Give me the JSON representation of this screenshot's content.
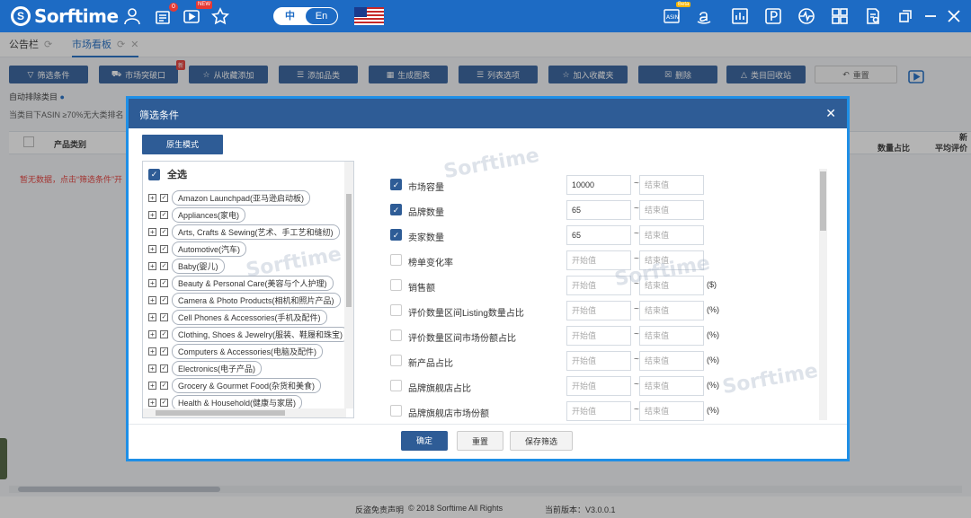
{
  "app": {
    "logo_text": "Sorftime",
    "logo_mark": "S",
    "notif_count": "0",
    "video_badge": "NEW",
    "lang_zh": "中",
    "lang_en": "En",
    "beta": "Beta"
  },
  "tabs": [
    {
      "label": "公告栏"
    },
    {
      "label": "市场看板"
    }
  ],
  "toolbar": {
    "filter": "筛选条件",
    "breakthrough": "市场突破口",
    "new_badge": "新",
    "add_from_fav": "从收藏添加",
    "add_category": "添加品类",
    "gen_chart": "生成图表",
    "columns": "列表选项",
    "add_fav": "加入收藏夹",
    "delete": "删除",
    "recycle": "类目回收站",
    "reset": "重置"
  },
  "background": {
    "auto_exclude": "自动排除类目",
    "rule": "当类目下ASIN ≥70%无大类排名",
    "col_category": "产品类别",
    "empty_msg": "暂无数据，点击“筛选条件”开",
    "right_cols": [
      "数量占比",
      "平均评价"
    ],
    "new_label": "新"
  },
  "modal": {
    "title": "筛选条件",
    "mode_button": "原生模式",
    "select_all": "全选",
    "categories": [
      "Amazon Launchpad(亚马逊启动板)",
      "Appliances(家电)",
      "Arts, Crafts & Sewing(艺术、手工艺和缝纫)",
      "Automotive(汽车)",
      "Baby(婴儿)",
      "Beauty & Personal Care(美容与个人护理)",
      "Camera & Photo Products(相机和照片产品)",
      "Cell Phones & Accessories(手机及配件)",
      "Clothing, Shoes & Jewelry(服装、鞋履和珠宝)",
      "Computers & Accessories(电脑及配件)",
      "Electronics(电子产品)",
      "Grocery & Gourmet Food(杂货和美食)",
      "Health & Household(健康与家居)"
    ],
    "filters": [
      {
        "label": "市场容量",
        "checked": true,
        "from": "10000",
        "to_placeholder": "结束值",
        "unit": ""
      },
      {
        "label": "品牌数量",
        "checked": true,
        "from": "65",
        "to_placeholder": "结束值",
        "unit": ""
      },
      {
        "label": "卖家数量",
        "checked": true,
        "from": "65",
        "to_placeholder": "结束值",
        "unit": ""
      },
      {
        "label": "榜单变化率",
        "checked": false,
        "from_placeholder": "开始值",
        "to_placeholder": "结束值",
        "unit": ""
      },
      {
        "label": "销售额",
        "checked": false,
        "from_placeholder": "开始值",
        "to_placeholder": "结束值",
        "unit": "($)"
      },
      {
        "label": "评价数量区间Listing数量占比",
        "checked": false,
        "from_placeholder": "开始值",
        "to_placeholder": "结束值",
        "unit": "(%)"
      },
      {
        "label": "评价数量区间市场份额占比",
        "checked": false,
        "from_placeholder": "开始值",
        "to_placeholder": "结束值",
        "unit": "(%)"
      },
      {
        "label": "新产品占比",
        "checked": false,
        "from_placeholder": "开始值",
        "to_placeholder": "结束值",
        "unit": "(%)"
      },
      {
        "label": "品牌旗舰店占比",
        "checked": false,
        "from_placeholder": "开始值",
        "to_placeholder": "结束值",
        "unit": "(%)"
      },
      {
        "label": "品牌旗舰店市场份额",
        "checked": false,
        "from_placeholder": "开始值",
        "to_placeholder": "结束值",
        "unit": "(%)"
      }
    ],
    "confirm": "确定",
    "reset": "重置",
    "save": "保存筛选"
  },
  "footer": {
    "disclaimer": "反盗免责声明",
    "copyright": "© 2018 Sorftime All Rights",
    "version": "当前版本：V3.0.0.1"
  },
  "watermark": "Sorftime"
}
